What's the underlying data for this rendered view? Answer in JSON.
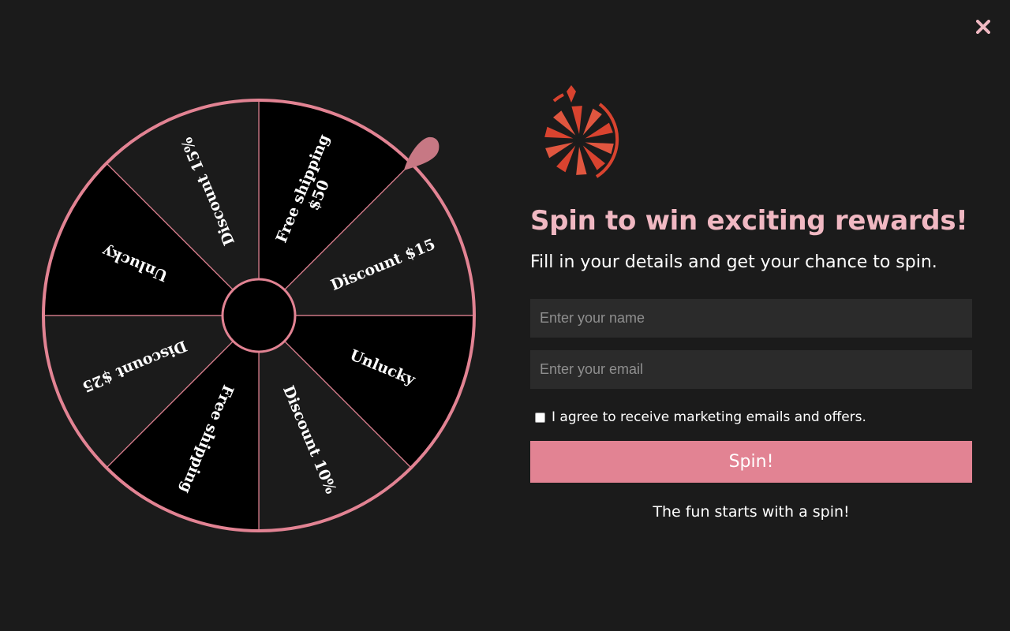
{
  "close_icon": "close-icon",
  "wheel": {
    "segments": [
      {
        "label_lines": [
          "Free shipping",
          "$50"
        ],
        "fill": "#000000"
      },
      {
        "label_lines": [
          "Discount $15"
        ],
        "fill": "#1b1b1b"
      },
      {
        "label_lines": [
          "Unlucky"
        ],
        "fill": "#000000"
      },
      {
        "label_lines": [
          "Discount 10%"
        ],
        "fill": "#1b1b1b"
      },
      {
        "label_lines": [
          "Free shipping"
        ],
        "fill": "#000000"
      },
      {
        "label_lines": [
          "Discount $25"
        ],
        "fill": "#1b1b1b"
      },
      {
        "label_lines": [
          "Unlucky"
        ],
        "fill": "#000000"
      },
      {
        "label_lines": [
          "Discount 15%"
        ],
        "fill": "#1b1b1b"
      }
    ],
    "rim_color": "#e28393",
    "pointer_color": "#c77884"
  },
  "logo": {
    "icon": "spin-wheel-logo-icon",
    "color": "#d9432f"
  },
  "headline": "Spin to win exciting rewards!",
  "subtitle": "Fill in your details and get your chance to spin.",
  "form": {
    "name_placeholder": "Enter your name",
    "email_placeholder": "Enter your email",
    "consent_label": "I agree to receive marketing emails and offers.",
    "spin_label": "Spin!"
  },
  "footer_text": "The fun starts with a spin!",
  "colors": {
    "accent": "#e28393",
    "headline": "#f0b8c2",
    "background": "#1b1b1b"
  }
}
